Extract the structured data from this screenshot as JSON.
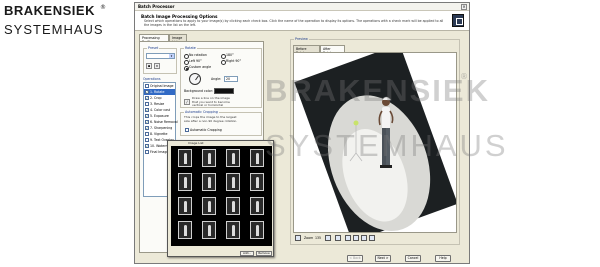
{
  "brand": {
    "line1": "BRAKENSIEK",
    "line2": "SYSTEMHAUS",
    "registered": "®"
  },
  "watermark": {
    "line1": "BRAKENSIEK",
    "line2": "SYSTEMHAUS",
    "registered": "®"
  },
  "window": {
    "title": "Batch Processor",
    "close": "×"
  },
  "header": {
    "title": "Batch Image Processing Options",
    "description": "Select which operations to apply to your image(s) by clicking each check box. Click the name of the operation to display its options. The operations with a check mark will be applied to all the images in the list on the left."
  },
  "left_tabs": [
    "Processing Profile",
    "Image List"
  ],
  "preset": {
    "label": "Preset",
    "value": ""
  },
  "operations": {
    "label": "Operations",
    "items": [
      {
        "label": "Original Image",
        "checked": false,
        "selected": false
      },
      {
        "label": "1. Rotate",
        "checked": true,
        "selected": true
      },
      {
        "label": "2. Crop",
        "checked": true,
        "selected": false
      },
      {
        "label": "3. Resize",
        "checked": false,
        "selected": false
      },
      {
        "label": "4. Color cast",
        "checked": true,
        "selected": false
      },
      {
        "label": "5. Exposure",
        "checked": true,
        "selected": false
      },
      {
        "label": "6. Noise Removal",
        "checked": true,
        "selected": false
      },
      {
        "label": "7. Sharpening",
        "checked": true,
        "selected": false
      },
      {
        "label": "8. Vignette",
        "checked": false,
        "selected": false
      },
      {
        "label": "9. Text Overlay",
        "checked": false,
        "selected": false
      },
      {
        "label": "10. Watermark",
        "checked": true,
        "selected": false
      },
      {
        "label": "Final Image",
        "checked": false,
        "selected": false
      }
    ]
  },
  "rotate": {
    "label": "Rotate",
    "options": [
      "No rotation",
      "Left 90°",
      "Custom angle",
      "180°",
      "Right 90°"
    ],
    "selected": "Custom angle",
    "angle_label": "Angle:",
    "angle_value": "20",
    "bg_label": "Background color:",
    "bg_color": "#000000",
    "hint": "Draw a line on the image that you want to become vertical or horizontal"
  },
  "auto_crop": {
    "label": "Automatic Cropping",
    "text": "This crops the image to the largest size after a non-90 degree rotation.",
    "checkbox": "Automatic Cropping"
  },
  "image_list_popup": {
    "title": "Image List",
    "thumbs": [
      "",
      "",
      "",
      "",
      "",
      "",
      "",
      "",
      "",
      "",
      "",
      "",
      "",
      "",
      "",
      ""
    ],
    "add": "Add...",
    "remove": "Remove"
  },
  "preview": {
    "label": "Preview",
    "tabs": [
      "Before Rotate",
      "After Rotate"
    ],
    "zoom_label": "Zoom",
    "zoom_value": "135"
  },
  "buttons": {
    "back": "< Back",
    "next": "Next >",
    "cancel": "Cancel",
    "help": "Help"
  }
}
